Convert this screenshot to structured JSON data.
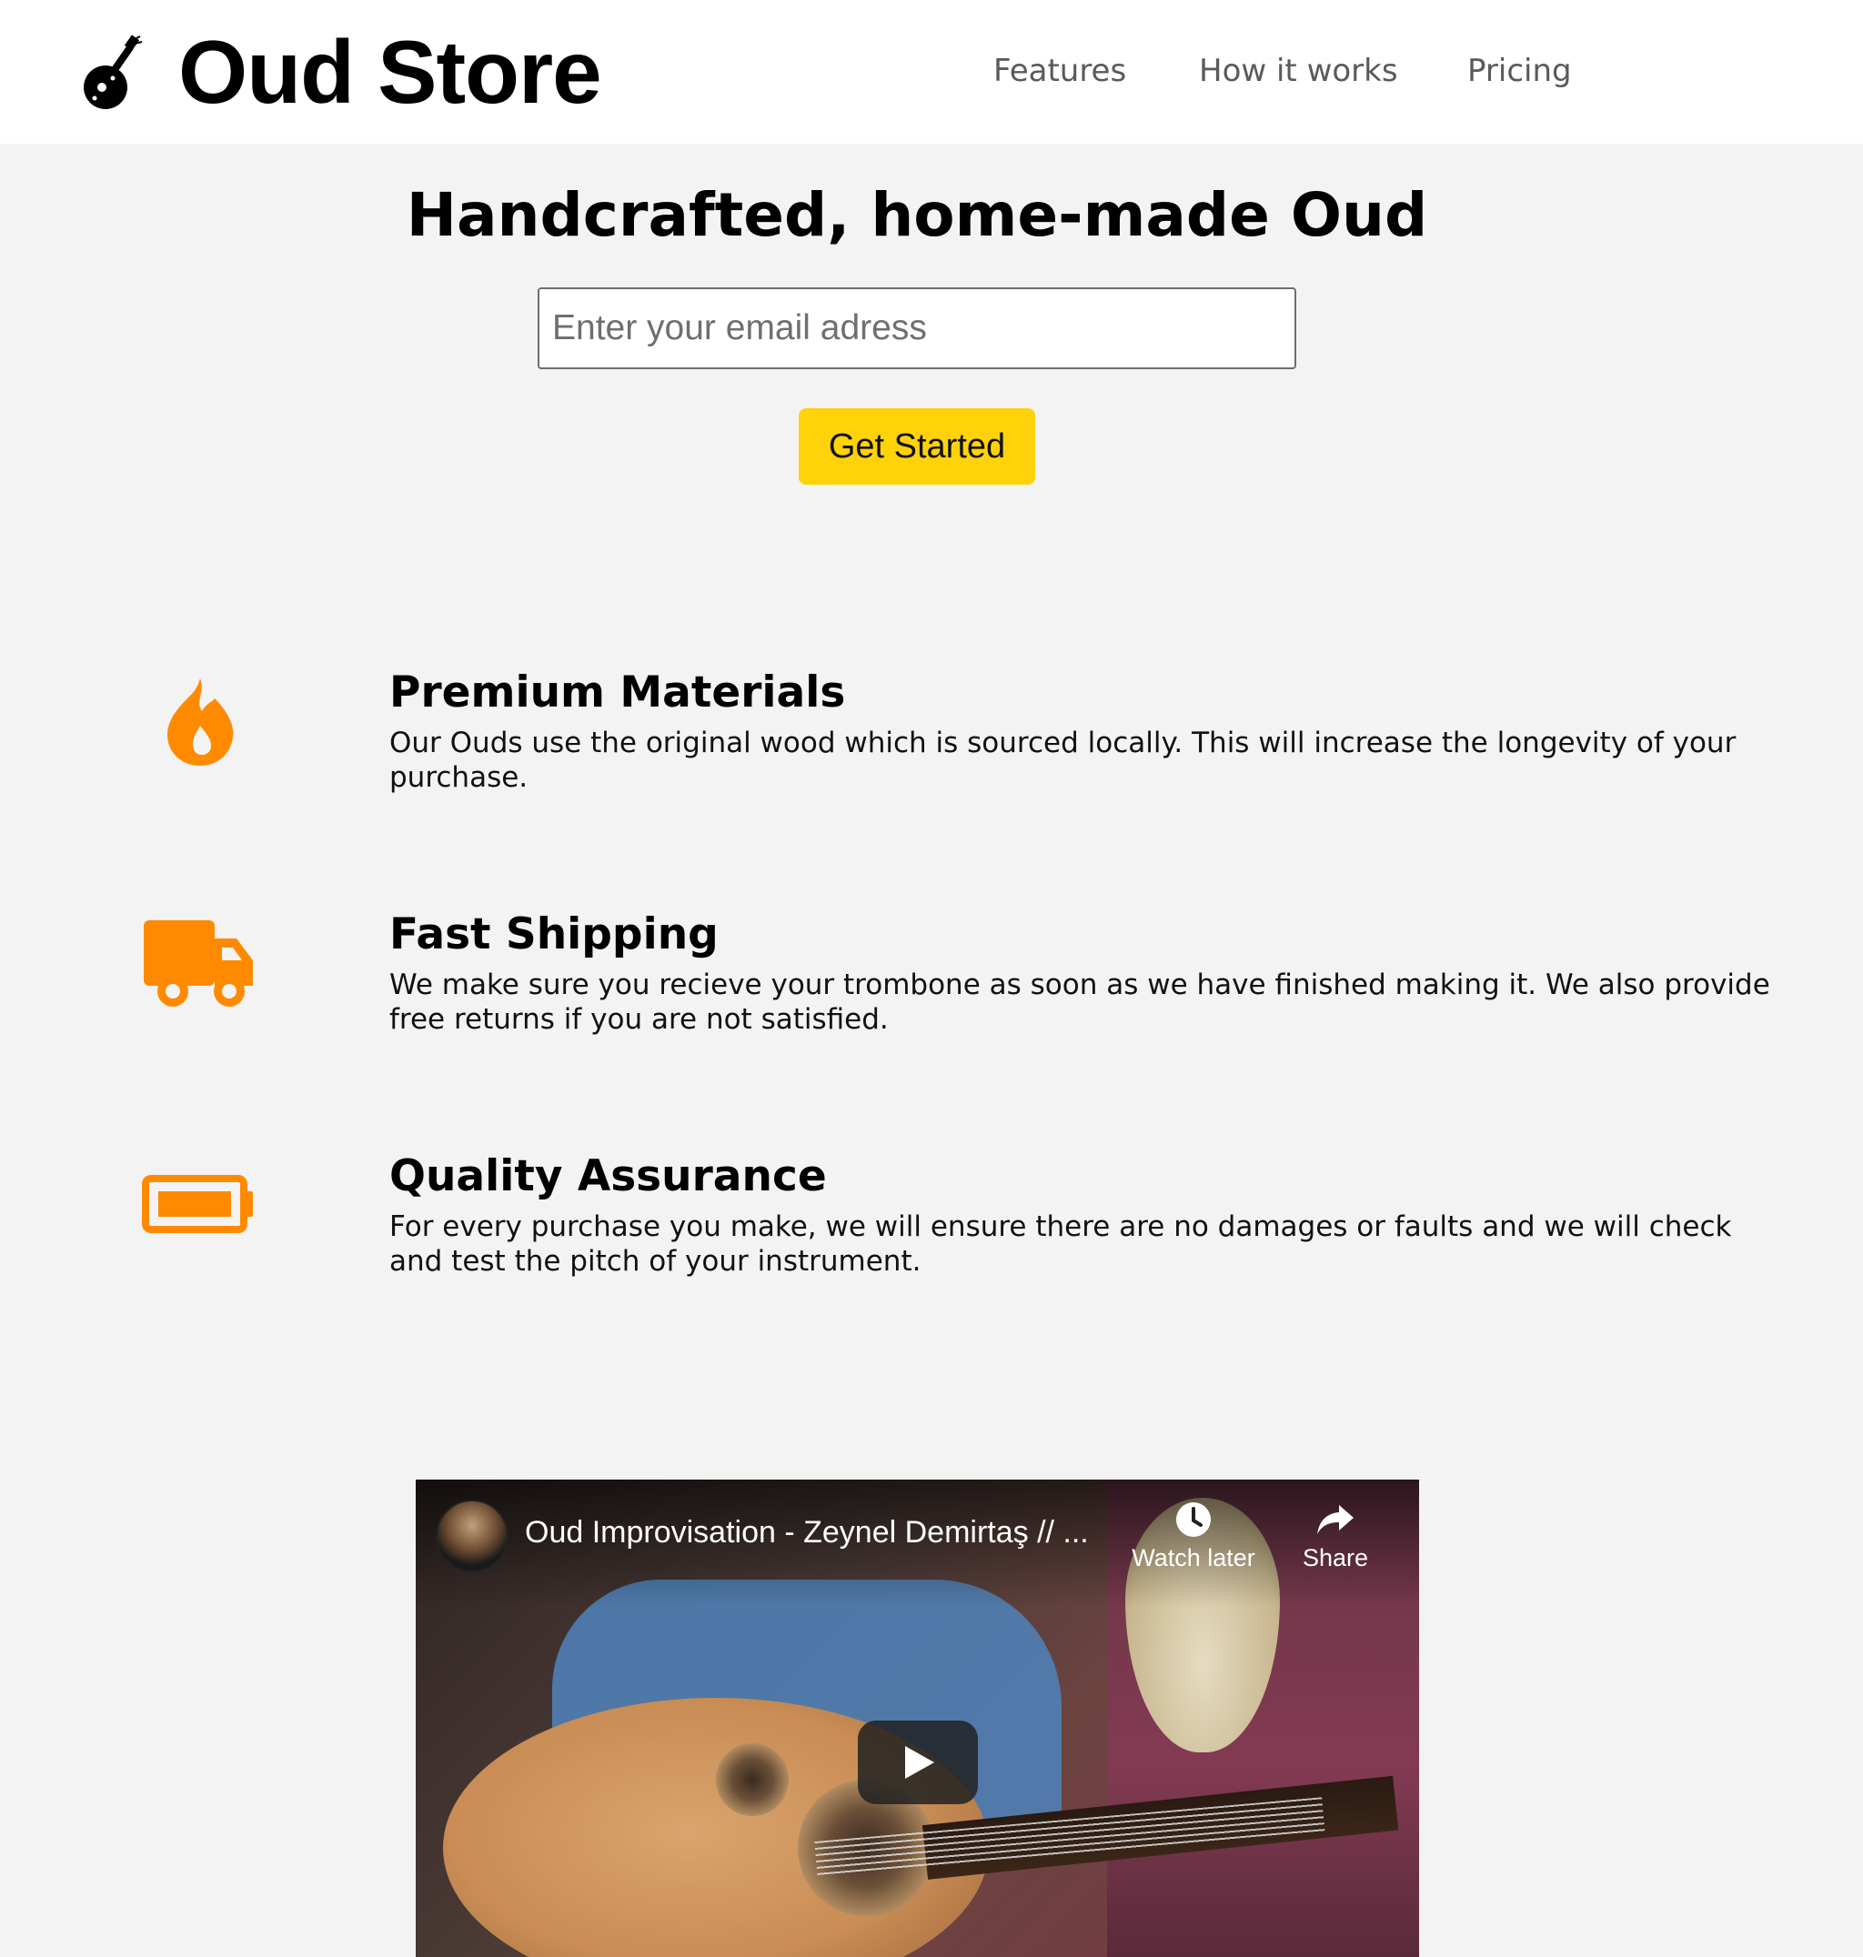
{
  "header": {
    "brand": "Oud Store",
    "logo_icon": "oud-icon",
    "nav": [
      {
        "label": "Features"
      },
      {
        "label": "How it works"
      },
      {
        "label": "Pricing"
      }
    ]
  },
  "hero": {
    "title": "Handcrafted, home-made Oud",
    "email_placeholder": "Enter your email adress",
    "cta_label": "Get Started"
  },
  "features": [
    {
      "icon": "fire-icon",
      "title": "Premium Materials",
      "text": "Our Ouds use the original wood which is sourced locally. This will increase the longevity of your purchase."
    },
    {
      "icon": "truck-icon",
      "title": "Fast Shipping",
      "text": "We make sure you recieve your trombone as soon as we have finished making it. We also provide free returns if you are not satisfied."
    },
    {
      "icon": "battery-icon",
      "title": "Quality Assurance",
      "text": "For every purchase you make, we will ensure there are no damages or faults and we will check and test the pitch of your instrument."
    }
  ],
  "video": {
    "title": "Oud Improvisation - Zeynel Demirtaş // ...",
    "watch_later": "Watch later",
    "share": "Share",
    "play_icon": "play-icon"
  },
  "colors": {
    "accent": "#ff8a00",
    "cta": "#ffd20a",
    "background": "#f3f3f3",
    "header": "#ffffff"
  }
}
